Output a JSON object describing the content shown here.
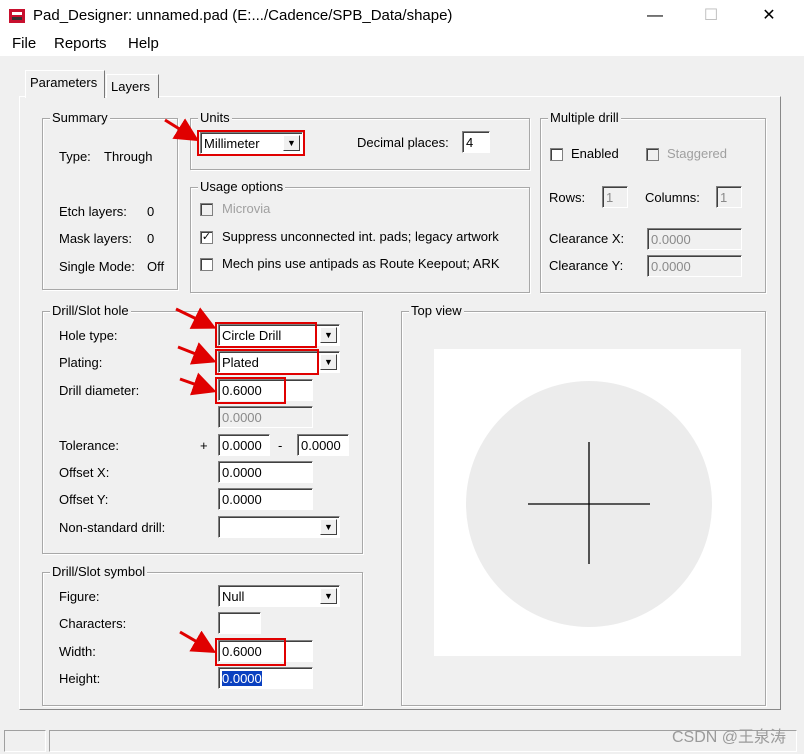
{
  "window": {
    "title": "Pad_Designer: unnamed.pad (E:.../Cadence/SPB_Data/shape)",
    "minimize_glyph": "—",
    "maximize_glyph": "☐",
    "close_glyph": "✕"
  },
  "menu": [
    "File",
    "Reports",
    "Help"
  ],
  "tabs": [
    "Parameters",
    "Layers"
  ],
  "summary": {
    "legend": "Summary",
    "type_label": "Type:",
    "type_value": "Through",
    "etch_label": "Etch layers:",
    "etch_value": "0",
    "mask_label": "Mask layers:",
    "mask_value": "0",
    "single_label": "Single Mode:",
    "single_value": "Off"
  },
  "units": {
    "legend": "Units",
    "value": "Millimeter",
    "decimal_label": "Decimal places:",
    "decimal_value": "4"
  },
  "usage": {
    "legend": "Usage options",
    "options": [
      {
        "label": "Microvia",
        "checked": false,
        "disabled": true
      },
      {
        "label": "Suppress unconnected int. pads; legacy artwork",
        "checked": true,
        "disabled": false
      },
      {
        "label": "Mech pins use antipads as Route Keepout; ARK",
        "checked": false,
        "disabled": false
      }
    ]
  },
  "multiple_drill": {
    "legend": "Multiple drill",
    "enabled_label": "Enabled",
    "staggered_label": "Staggered",
    "rows_label": "Rows:",
    "rows_value": "1",
    "columns_label": "Columns:",
    "columns_value": "1",
    "clearance_x_label": "Clearance X:",
    "clearance_x_value": "0.0000",
    "clearance_y_label": "Clearance Y:",
    "clearance_y_value": "0.0000"
  },
  "drill_hole": {
    "legend": "Drill/Slot hole",
    "hole_type_label": "Hole type:",
    "hole_type_value": "Circle Drill",
    "plating_label": "Plating:",
    "plating_value": "Plated",
    "diameter_label": "Drill diameter:",
    "diameter_value": "0.6000",
    "secondary_value": "0.0000",
    "tolerance_label": "Tolerance:",
    "tol_plus": "+",
    "tol_plus_value": "0.0000",
    "tol_minus": "-",
    "tol_minus_value": "0.0000",
    "offset_x_label": "Offset X:",
    "offset_x_value": "0.0000",
    "offset_y_label": "Offset Y:",
    "offset_y_value": "0.0000",
    "nonstandard_label": "Non-standard drill:",
    "nonstandard_value": ""
  },
  "drill_symbol": {
    "legend": "Drill/Slot symbol",
    "figure_label": "Figure:",
    "figure_value": "Null",
    "characters_label": "Characters:",
    "characters_value": "",
    "width_label": "Width:",
    "width_value": "0.6000",
    "height_label": "Height:",
    "height_value": "0.0000"
  },
  "top_view": {
    "legend": "Top view"
  },
  "colors": {
    "annotation_red": "#e00000",
    "selection_blue": "#0a40c0",
    "window_bg": "#f0f0f0"
  },
  "watermark": "CSDN @王泉涛"
}
